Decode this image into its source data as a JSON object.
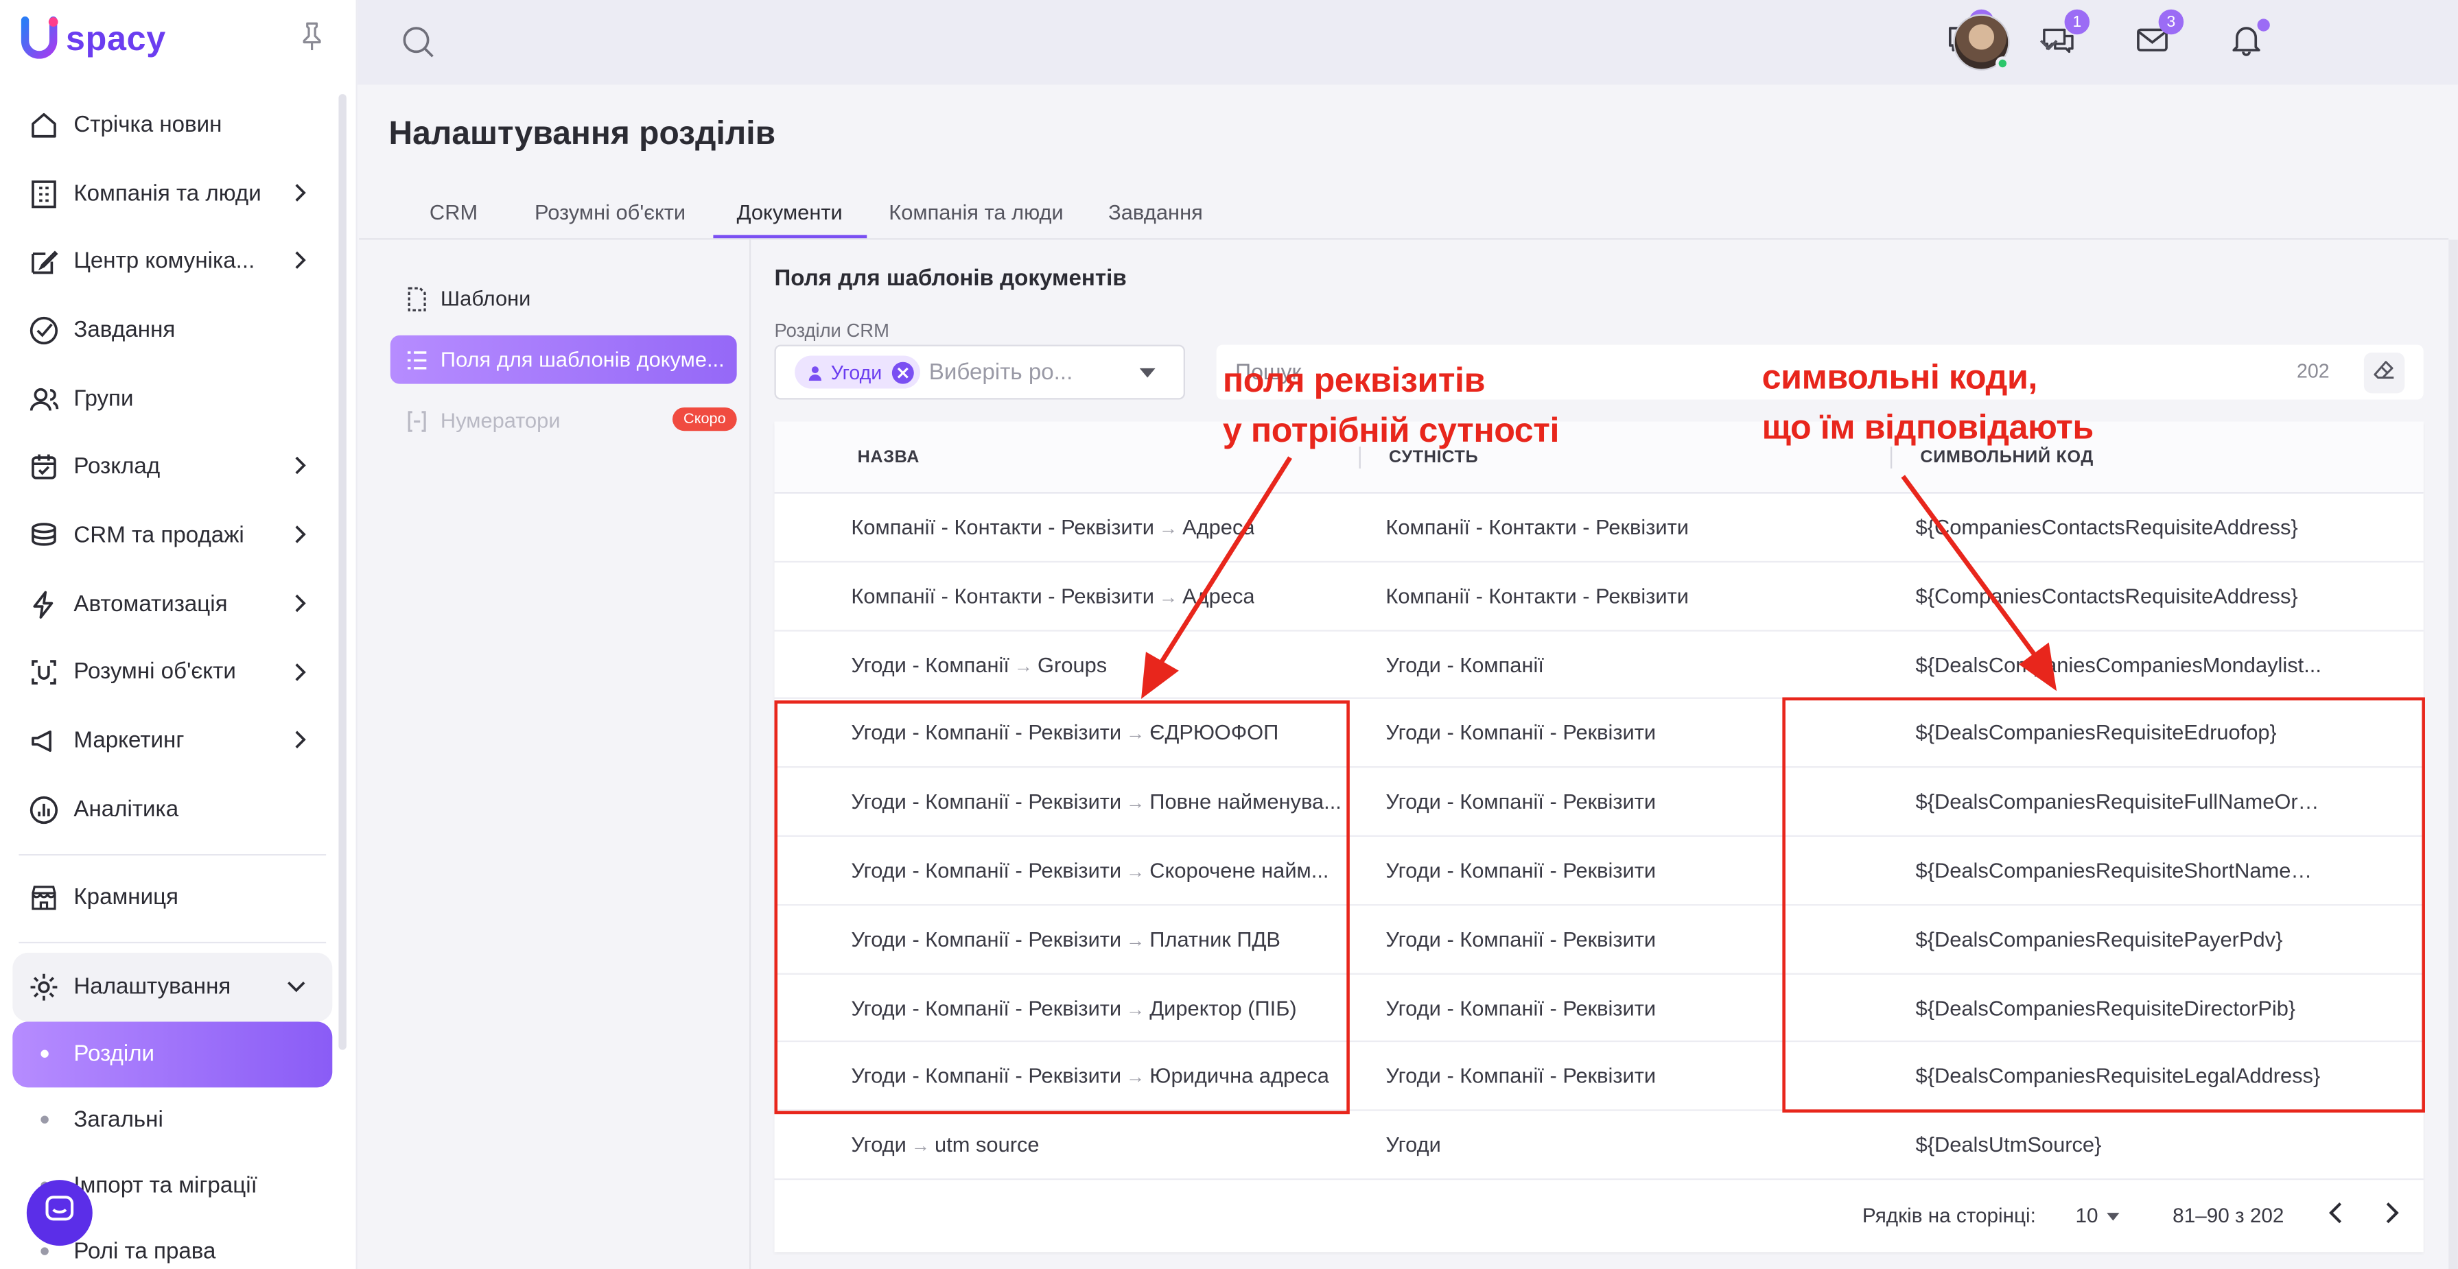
{
  "brand": {
    "name": "spacy",
    "logo_letter": "U",
    "accent": "#7a4ff2",
    "annotation_color": "#e8261c"
  },
  "sidebar": {
    "items": [
      {
        "label": "Стрічка новин",
        "icon": "home-icon",
        "chevron": false
      },
      {
        "label": "Компанія та люди",
        "icon": "building-icon",
        "chevron": true
      },
      {
        "label": "Центр комуніка...",
        "icon": "edit-icon",
        "chevron": true
      },
      {
        "label": "Завдання",
        "icon": "check-circle-icon",
        "chevron": false
      },
      {
        "label": "Групи",
        "icon": "users-icon",
        "chevron": false
      },
      {
        "label": "Розклад",
        "icon": "calendar-icon",
        "chevron": true
      },
      {
        "label": "CRM та продажі",
        "icon": "coins-icon",
        "chevron": true
      },
      {
        "label": "Автоматизація",
        "icon": "lightning-icon",
        "chevron": true
      },
      {
        "label": "Розумні об'єкти",
        "icon": "smart-object-icon",
        "chevron": true
      },
      {
        "label": "Маркетинг",
        "icon": "megaphone-icon",
        "chevron": true
      },
      {
        "label": "Аналітика",
        "icon": "chart-icon",
        "chevron": false
      }
    ],
    "store": {
      "label": "Крамниця",
      "icon": "store-icon"
    },
    "settings": {
      "label": "Налаштування",
      "icon": "gear-icon"
    },
    "settings_sub": [
      {
        "label": "Розділи",
        "active": true
      },
      {
        "label": "Загальні",
        "active": false
      },
      {
        "label": "Імпорт та міграції",
        "active": false
      },
      {
        "label": "Ролі та права",
        "active": false
      }
    ]
  },
  "topbar": {
    "badges": {
      "chat": "1",
      "messages": "1",
      "mail": "3"
    }
  },
  "page": {
    "title": "Налаштування розділів",
    "tabs": [
      "CRM",
      "Розумні об'єкти",
      "Документи",
      "Компанія та люди",
      "Завдання"
    ],
    "active_tab": "Документи"
  },
  "left_menu": {
    "templates": "Шаблони",
    "fields": "Поля для шаблонів докуме...",
    "numerators": "Нумератори",
    "soon_badge": "Скоро"
  },
  "content": {
    "section_title": "Поля для шаблонів документів",
    "crm_label": "Розділи CRM",
    "chip": "Угоди",
    "select_placeholder": "Виберіть ро...",
    "search_placeholder": "Пошук",
    "total_count": "202"
  },
  "table": {
    "headers": [
      "НАЗВА",
      "СУТНІСТЬ",
      "СИМВОЛЬНИЙ КОД"
    ],
    "rows": [
      {
        "path": "Компанії - Контакти - Реквізити",
        "field": "Адреса",
        "entity": "Компанії - Контакти - Реквізити",
        "code": "${CompaniesContactsRequisiteAddress}"
      },
      {
        "path": "Компанії - Контакти - Реквізити",
        "field": "Адреса",
        "entity": "Компанії - Контакти - Реквізити",
        "code": "${CompaniesContactsRequisiteAddress}"
      },
      {
        "path": "Угоди - Компанії",
        "field": "Groups",
        "entity": "Угоди - Компанії",
        "code": "${DealsCompaniesCompaniesMondaylist..."
      },
      {
        "path": "Угоди - Компанії - Реквізити",
        "field": "ЄДРЮОФОП",
        "entity": "Угоди - Компанії - Реквізити",
        "code": "${DealsCompaniesRequisiteEdruofop}"
      },
      {
        "path": "Угоди - Компанії - Реквізити",
        "field": "Повне найменува...",
        "entity": "Угоди - Компанії - Реквізити",
        "code": "${DealsCompaniesRequisiteFullNameOrg..."
      },
      {
        "path": "Угоди - Компанії - Реквізити",
        "field": "Скорочене найм...",
        "entity": "Угоди - Компанії - Реквізити",
        "code": "${DealsCompaniesRequisiteShortNameO..."
      },
      {
        "path": "Угоди - Компанії - Реквізити",
        "field": "Платник ПДВ",
        "entity": "Угоди - Компанії - Реквізити",
        "code": "${DealsCompaniesRequisitePayerPdv}"
      },
      {
        "path": "Угоди - Компанії - Реквізити",
        "field": "Директор (ПІБ)",
        "entity": "Угоди - Компанії - Реквізити",
        "code": "${DealsCompaniesRequisiteDirectorPib}"
      },
      {
        "path": "Угоди - Компанії - Реквізити",
        "field": "Юридична адреса",
        "entity": "Угоди - Компанії - Реквізити",
        "code": "${DealsCompaniesRequisiteLegalAddress}"
      },
      {
        "path": "Угоди",
        "field": "utm source",
        "entity": "Угоди",
        "code": "${DealsUtmSource}"
      }
    ],
    "pager": {
      "rows_label": "Рядків на сторінці:",
      "rows_per_page": "10",
      "range": "81–90 з 202"
    }
  },
  "annotations": {
    "left": {
      "line1": "поля реквізитів",
      "line2": "у потрібній сутності"
    },
    "right": {
      "line1": "символьні коди,",
      "line2": "що їм відповідають"
    }
  }
}
